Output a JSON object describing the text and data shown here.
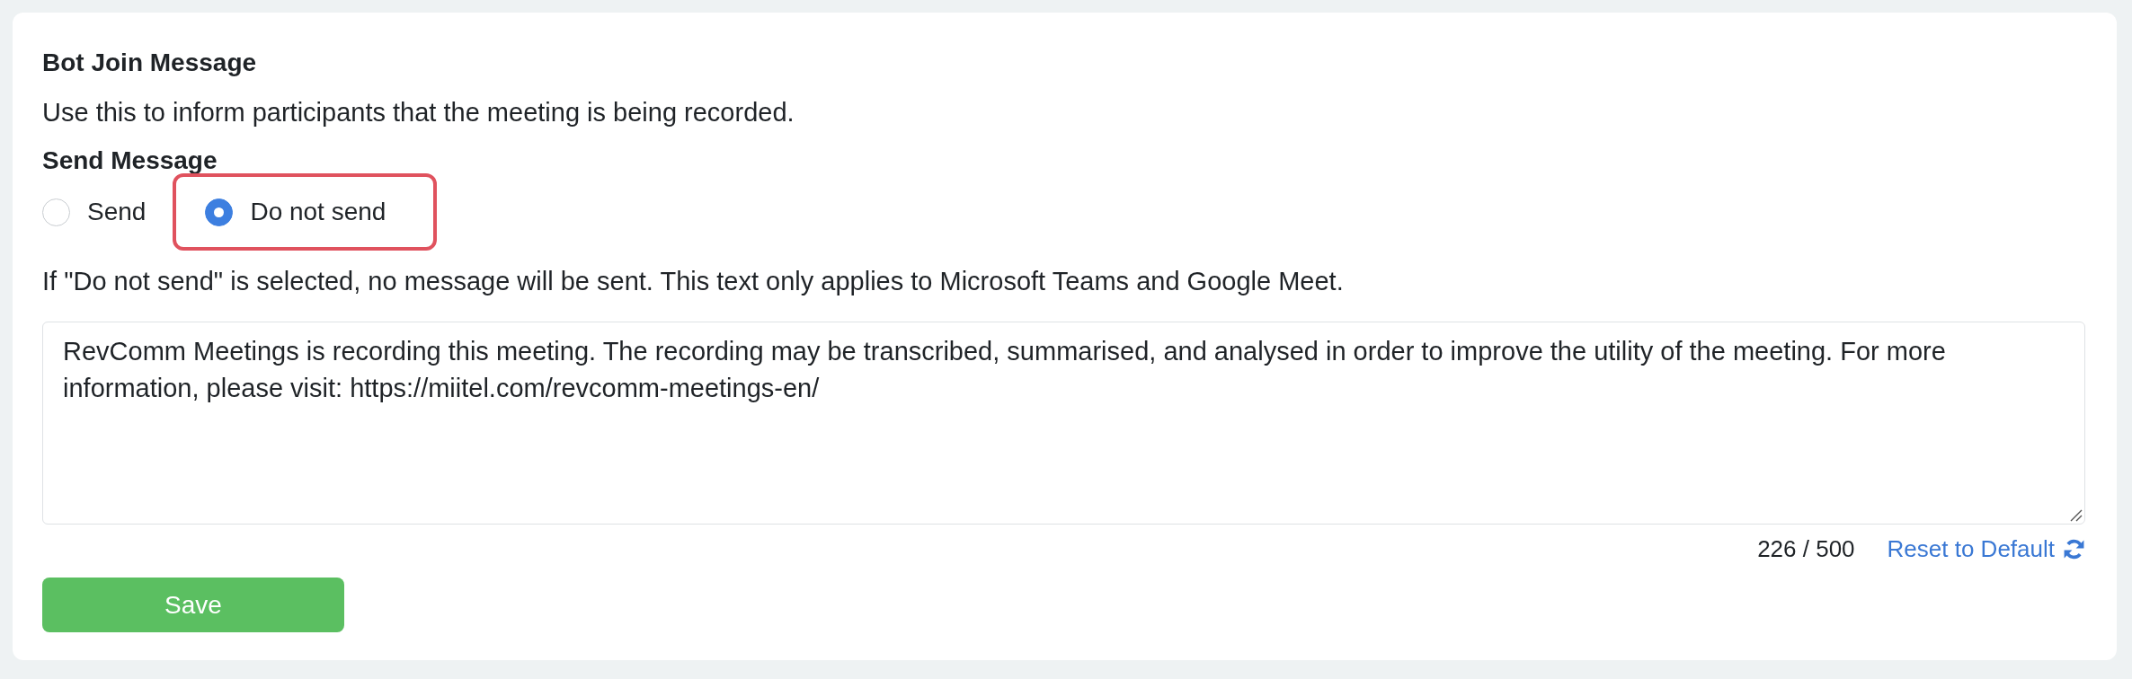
{
  "section": {
    "title": "Bot Join Message",
    "description": "Use this to inform participants that the meeting is being recorded."
  },
  "send_message": {
    "label": "Send Message",
    "options": [
      {
        "label": "Send",
        "selected": false,
        "highlighted": false
      },
      {
        "label": "Do not send",
        "selected": true,
        "highlighted": true
      }
    ],
    "note": "If \"Do not send\" is selected, no message will be sent. This text only applies to Microsoft Teams and Google Meet."
  },
  "message": {
    "value": "RevComm Meetings is recording this meeting. The recording may be transcribed, summarised, and analysed in order to improve the utility of the meeting. For more information, please visit: https://miitel.com/revcomm-meetings-en/",
    "counter": "226 / 500",
    "reset_link": "Reset to Default"
  },
  "save_button": "Save"
}
